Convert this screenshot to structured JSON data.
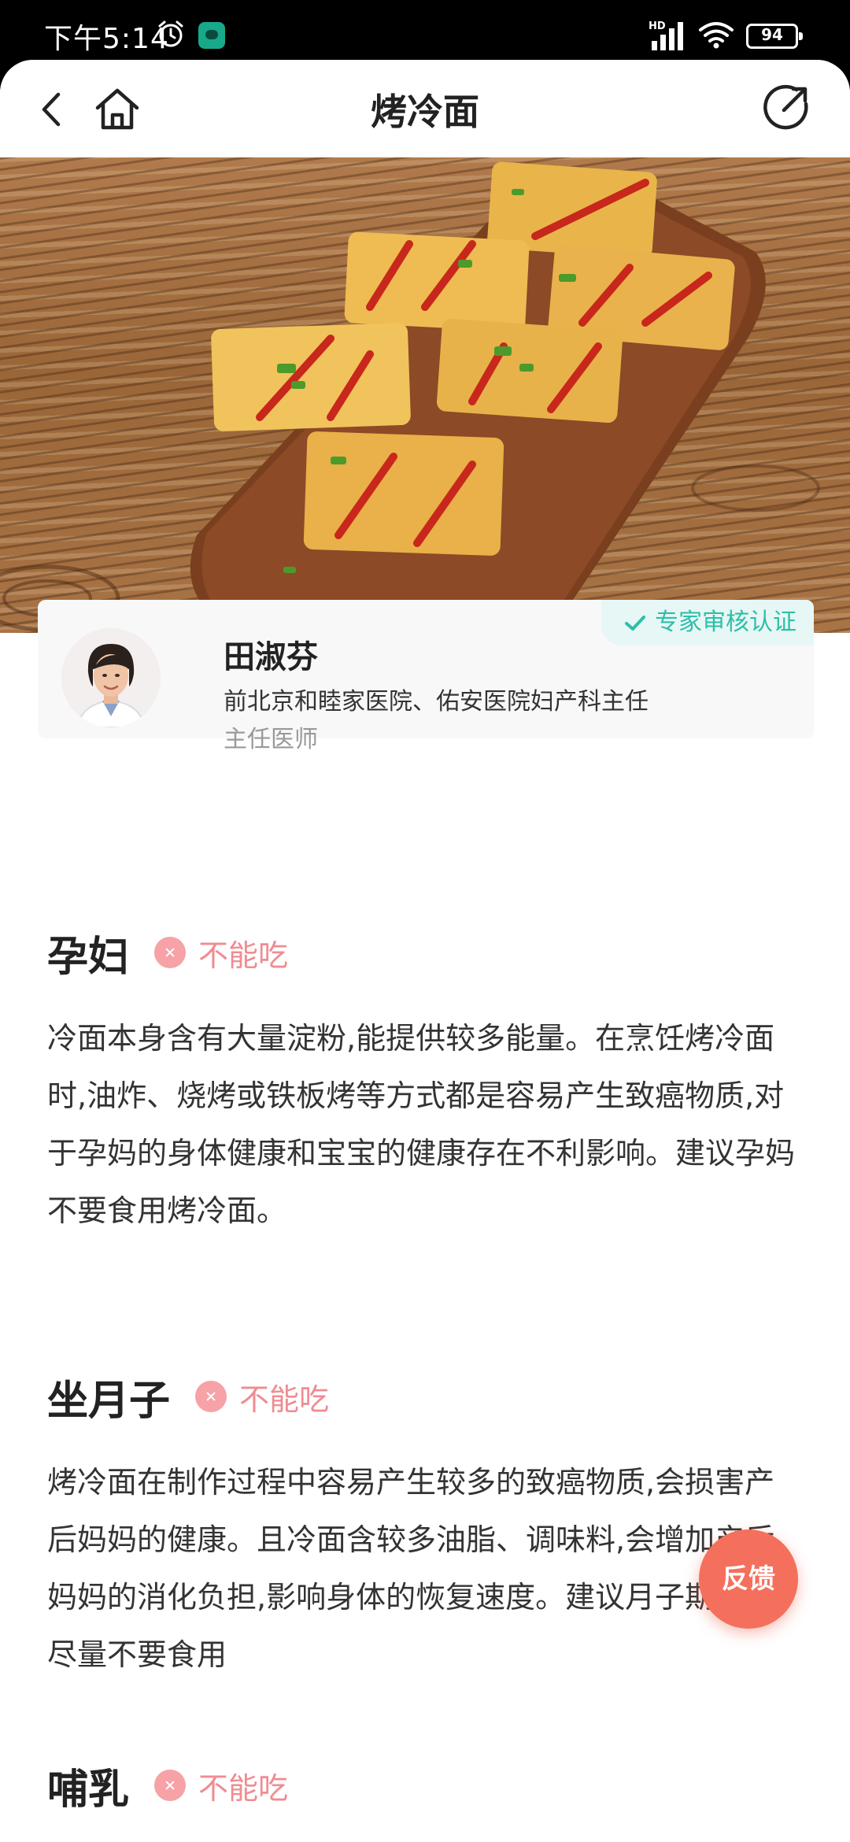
{
  "status_bar": {
    "time": "下午5:14",
    "network": "HD",
    "battery": "94"
  },
  "header": {
    "title": "烤冷面"
  },
  "expert": {
    "badge": "专家审核认证",
    "name": "田淑芬",
    "description": "前北京和睦家医院、佑安医院妇产科主任",
    "role": "主任医师"
  },
  "sections": [
    {
      "title": "孕妇",
      "verdict": "不能吃",
      "body": "冷面本身含有大量淀粉,能提供较多能量。在烹饪烤冷面时,油炸、烧烤或铁板烤等方式都是容易产生致癌物质,对于孕妈的身体健康和宝宝的健康存在不利影响。建议孕妈不要食用烤冷面。"
    },
    {
      "title": "坐月子",
      "verdict": "不能吃",
      "body": "烤冷面在制作过程中容易产生较多的致癌物质,会损害产后妈妈的健康。且冷面含较多油脂、调味料,会增加产后妈妈的消化负担,影响身体的恢复速度。建议月子期妈妈尽量不要食用"
    },
    {
      "title": "哺乳",
      "verdict": "不能吃",
      "body": ""
    }
  ],
  "feedback_label": "反馈",
  "colors": {
    "accent_teal": "#2dbfa8",
    "verdict_red": "#f08c92",
    "feedback": "#f4705c"
  }
}
